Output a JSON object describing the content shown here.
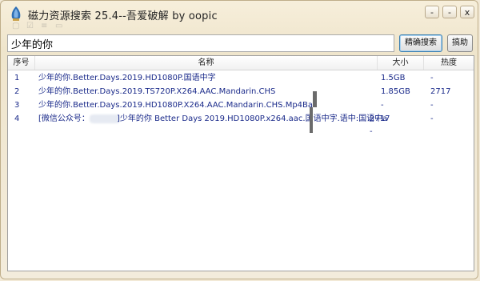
{
  "window": {
    "title": "磁力资源搜索 25.4--吾爱破解 by oopic",
    "minimize_label": "-",
    "maximize_label": "-",
    "close_label": "x"
  },
  "search": {
    "value": "少年的你",
    "exact_search_label": "精确搜索",
    "fuzzy_search_label": "搞助"
  },
  "table": {
    "columns": [
      "序号",
      "名称",
      "大小",
      "热度"
    ],
    "rows": [
      {
        "index": "1",
        "name": "少年的你.Better.Days.2019.HD1080P.国语中字",
        "size": "1.5GB",
        "heat": "-"
      },
      {
        "index": "2",
        "name": "少年的你.Better.Days.2019.TS720P.X264.AAC.Mandarin.CHS",
        "size": "1.85GB",
        "heat": "2717"
      },
      {
        "index": "3",
        "name": "少年的你.Better.Days.2019.HD1080P.X264.AAC.Mandarin.CHS.Mp4Ba",
        "size": "-",
        "heat": "-"
      },
      {
        "index": "4",
        "name_prefix": "[微信公众号：",
        "name_suffix": "]少年的你 Better Days 2019.HD1080P.x264.aac.国语中字.语中:国语中a",
        "size": "2717",
        "heat": "-",
        "extra": "-"
      }
    ]
  },
  "colors": {
    "row_text": "#1a2a8a",
    "window_bg": "#f2e9d6",
    "accent_border": "#3c7fb1"
  }
}
